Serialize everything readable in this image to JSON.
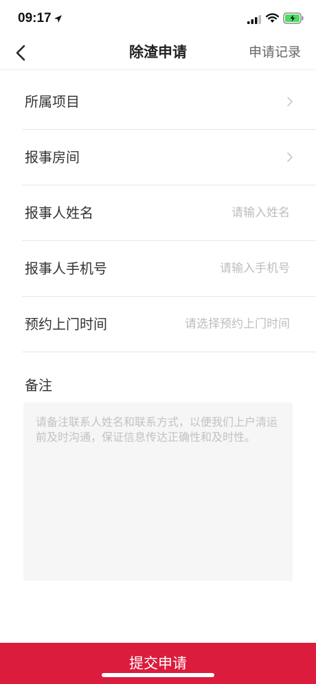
{
  "status_bar": {
    "time": "09:17",
    "icons": [
      "location-arrow-icon",
      "signal-icon",
      "wifi-icon",
      "battery-charging-icon"
    ],
    "battery_color": "#4cd964"
  },
  "nav": {
    "back_icon": "chevron-left-icon",
    "title": "除渣申请",
    "right_link": "申请记录"
  },
  "form": {
    "rows": [
      {
        "label": "所属项目",
        "value": "",
        "has_chevron": true
      },
      {
        "label": "报事房间",
        "value": "",
        "has_chevron": true
      },
      {
        "label": "报事人姓名",
        "placeholder": "请输入姓名",
        "has_chevron": false
      },
      {
        "label": "报事人手机号",
        "placeholder": "请输入手机号",
        "has_chevron": false
      },
      {
        "label": "预约上门时间",
        "placeholder": "请选择预约上门时间",
        "has_chevron": false
      }
    ]
  },
  "remarks": {
    "label": "备注",
    "placeholder": "请备注联系人姓名和联系方式，以便我们上户清运前及时沟通，保证信息传达正确性和及时性。"
  },
  "submit": {
    "label": "提交申请",
    "color": "#dc1c3d"
  }
}
